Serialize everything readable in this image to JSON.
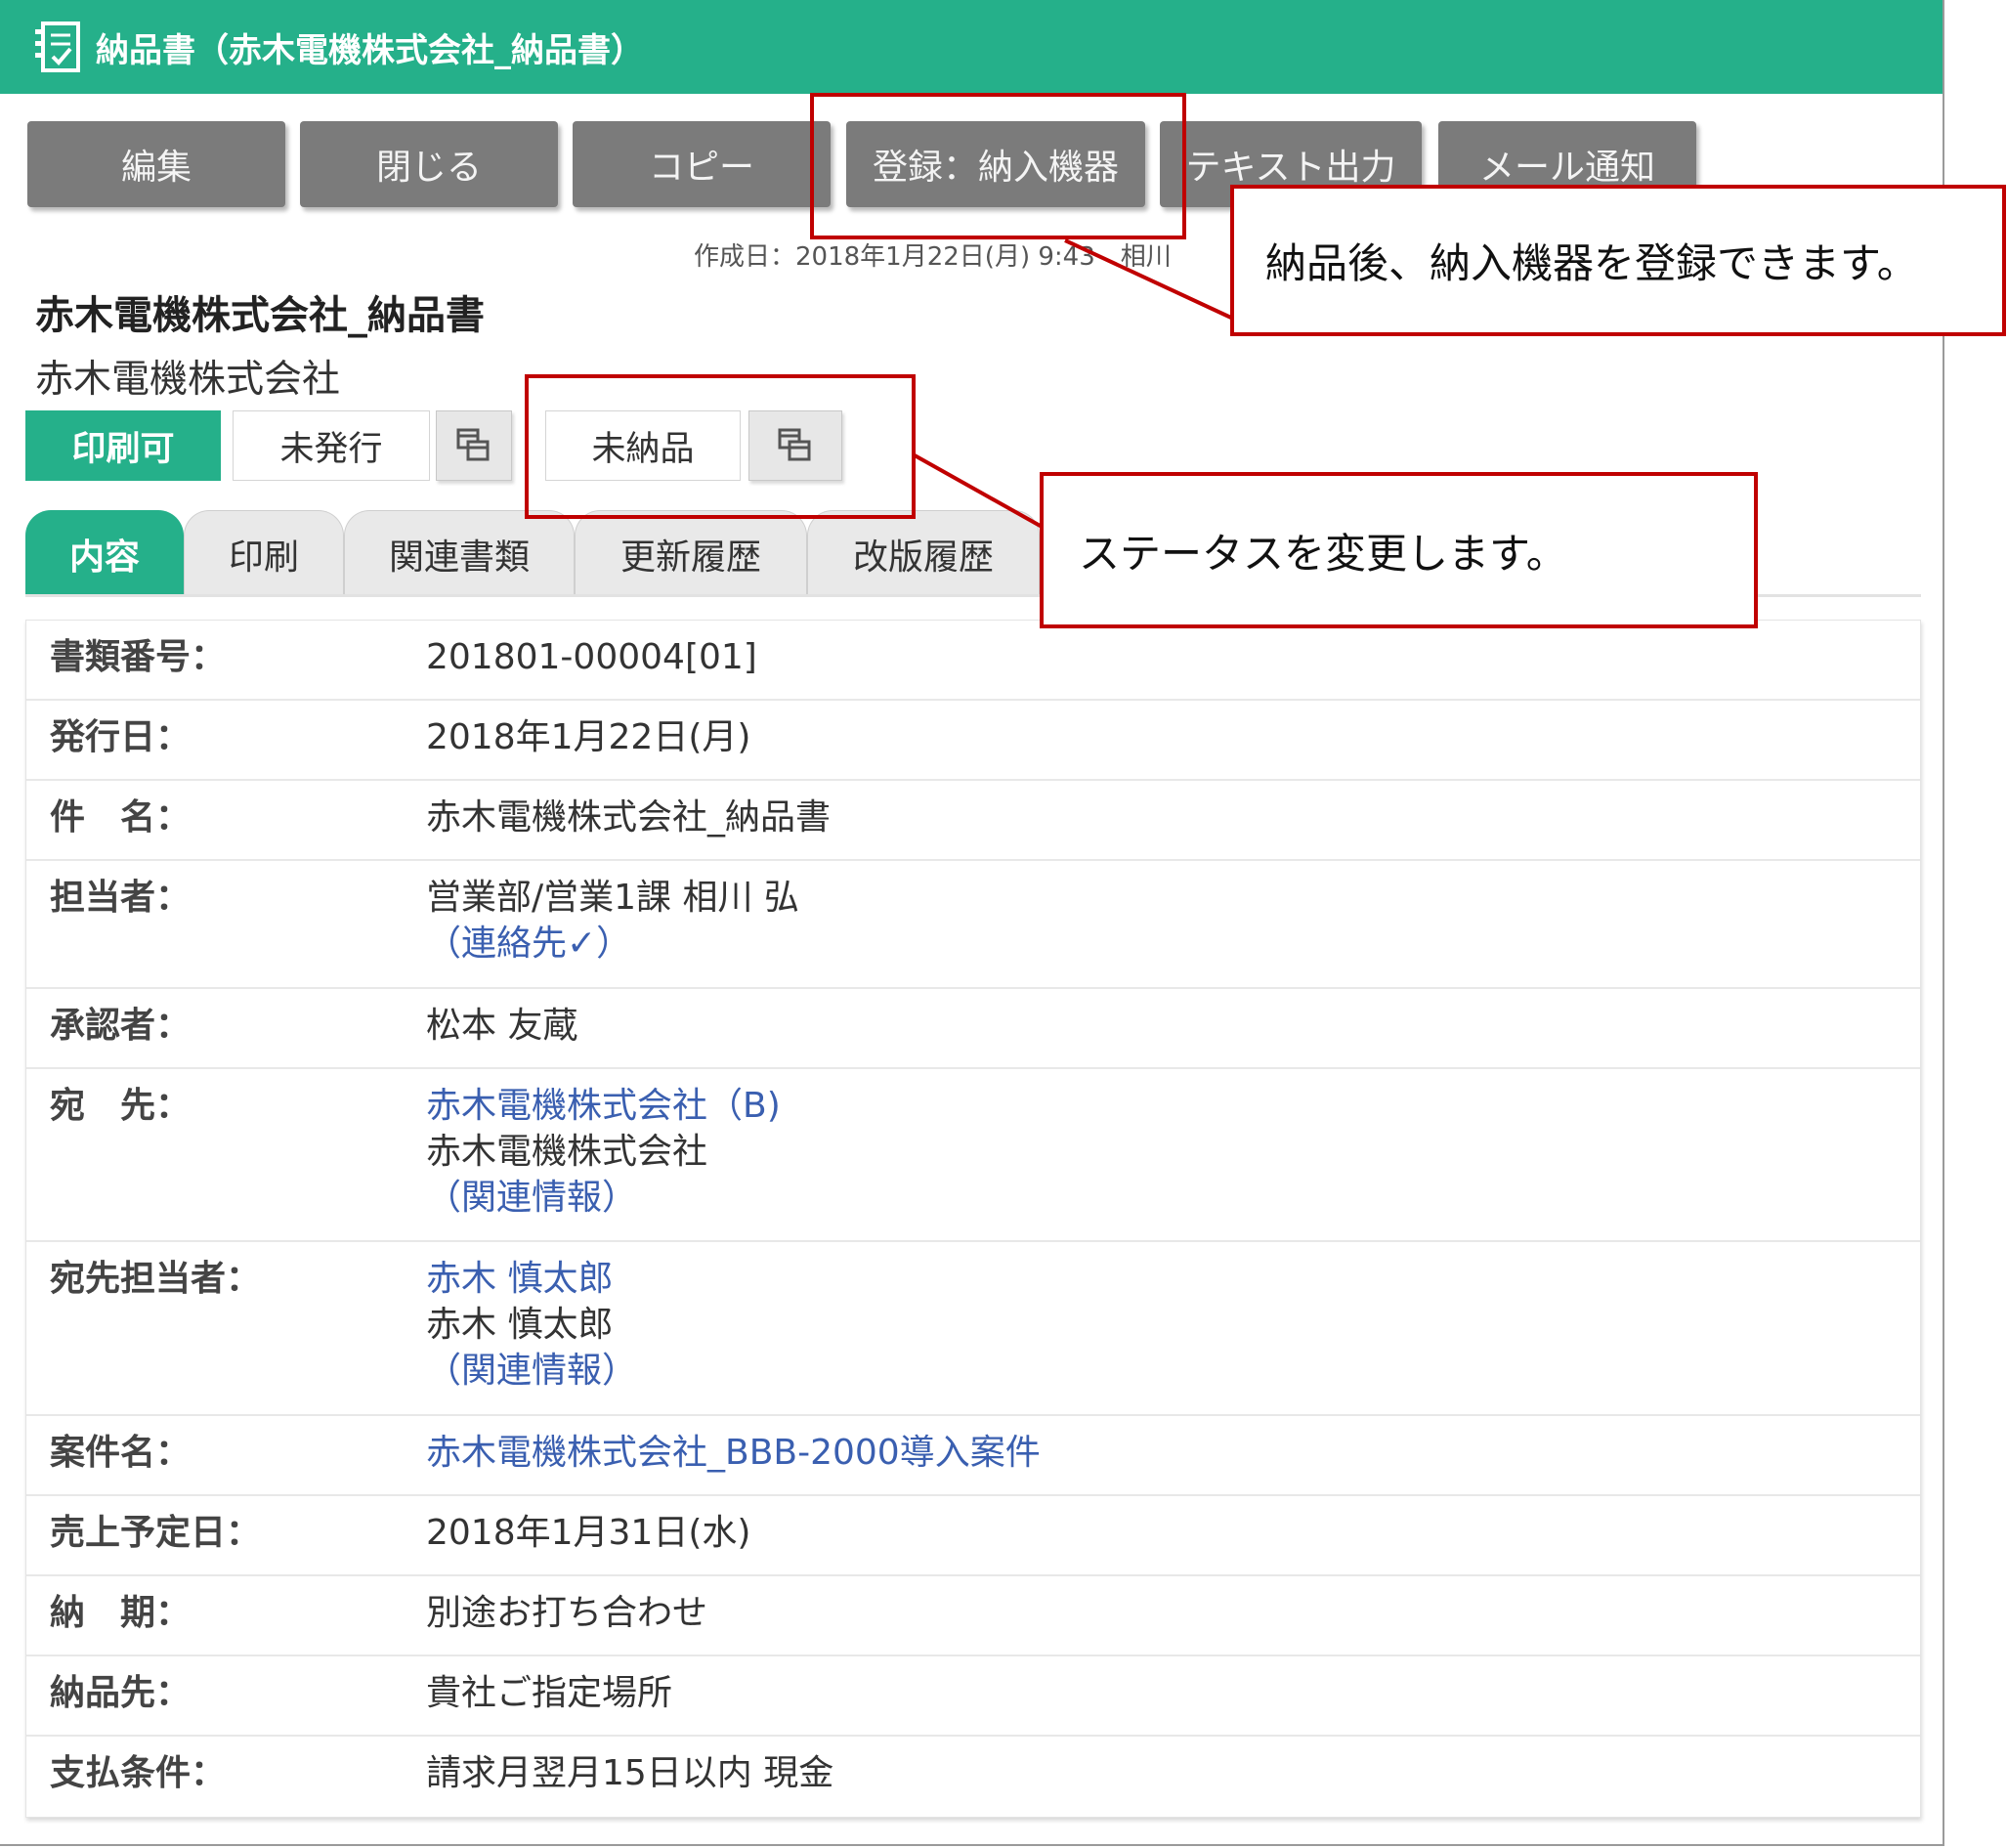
{
  "window": {
    "title": "納品書（赤木電機株式会社_納品書）"
  },
  "toolbar": {
    "buttons": [
      {
        "label": "編集"
      },
      {
        "label": "閉じる"
      },
      {
        "label": "コピー"
      },
      {
        "label": "登録：納入機器"
      },
      {
        "label": "テキスト出力"
      },
      {
        "label": "メール通知"
      }
    ]
  },
  "meta": {
    "created": "作成日：2018年1月22日(月) 9:43　相川"
  },
  "document": {
    "title": "赤木電機株式会社_納品書",
    "company": "赤木電機株式会社"
  },
  "statuses": {
    "print": "印刷可",
    "issue": "未発行",
    "delivery": "未納品",
    "copy_icon": "copy-icon"
  },
  "tabs": [
    {
      "label": "内容",
      "active": true
    },
    {
      "label": "印刷",
      "active": false
    },
    {
      "label": "関連書類",
      "active": false
    },
    {
      "label": "更新履歴",
      "active": false
    },
    {
      "label": "改版履歴",
      "active": false
    }
  ],
  "details": {
    "doc_no": {
      "label": "書類番号：",
      "value": "201801-00004[01]"
    },
    "issue_date": {
      "label": "発行日：",
      "value": "2018年1月22日(月)"
    },
    "subject": {
      "label": "件　名：",
      "value": "赤木電機株式会社_納品書"
    },
    "owner": {
      "label": "担当者：",
      "value": "営業部/営業1課 相川 弘",
      "link": "（連絡先✓）"
    },
    "approver": {
      "label": "承認者：",
      "value": "松本 友蔵"
    },
    "recipient": {
      "label": "宛　先：",
      "link": "赤木電機株式会社（B)",
      "value": "赤木電機株式会社",
      "info": "（関連情報）"
    },
    "recipient_contact": {
      "label": "宛先担当者：",
      "link": "赤木 慎太郎",
      "value": "赤木 慎太郎",
      "info": "（関連情報）"
    },
    "project": {
      "label": "案件名：",
      "link": "赤木電機株式会社_BBB-2000導入案件"
    },
    "sales_date": {
      "label": "売上予定日：",
      "value": "2018年1月31日(水)"
    },
    "deadline": {
      "label": "納　期：",
      "value": "別途お打ち合わせ"
    },
    "delivery_to": {
      "label": "納品先：",
      "value": "貴社ご指定場所"
    },
    "payment": {
      "label": "支払条件：",
      "value": "請求月翌月15日以内 現金"
    }
  },
  "callouts": {
    "register": "納品後、納入機器を登録できます。",
    "status": "ステータスを変更します。"
  },
  "colors": {
    "brand_green": "#25b08a",
    "button_gray": "#7b7b7b",
    "callout_red": "#c00000",
    "link_blue": "#3a5fb0"
  }
}
